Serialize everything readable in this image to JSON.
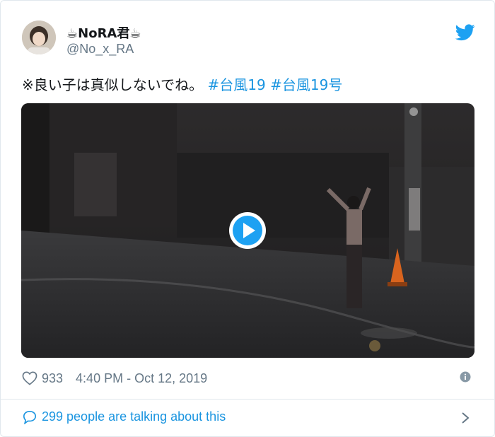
{
  "tweet": {
    "display_name": "☕NoRA君☕",
    "handle": "@No_x_RA",
    "text_plain": "※良い子は真似しないでね。",
    "hashtags": [
      "#台風19",
      "#台風19号"
    ],
    "likes": "933",
    "timestamp": "4:40 PM - Oct 12, 2019",
    "talking": "299 people are talking about this"
  },
  "icons": {
    "logo": "twitter-bird-icon",
    "play": "play-icon",
    "like": "heart-icon",
    "info": "info-icon",
    "reply": "speech-bubble-icon",
    "next": "chevron-right-icon"
  },
  "colors": {
    "link": "#1b95e0",
    "muted": "#657786",
    "text": "#14171a",
    "play": "#1da1f2"
  }
}
